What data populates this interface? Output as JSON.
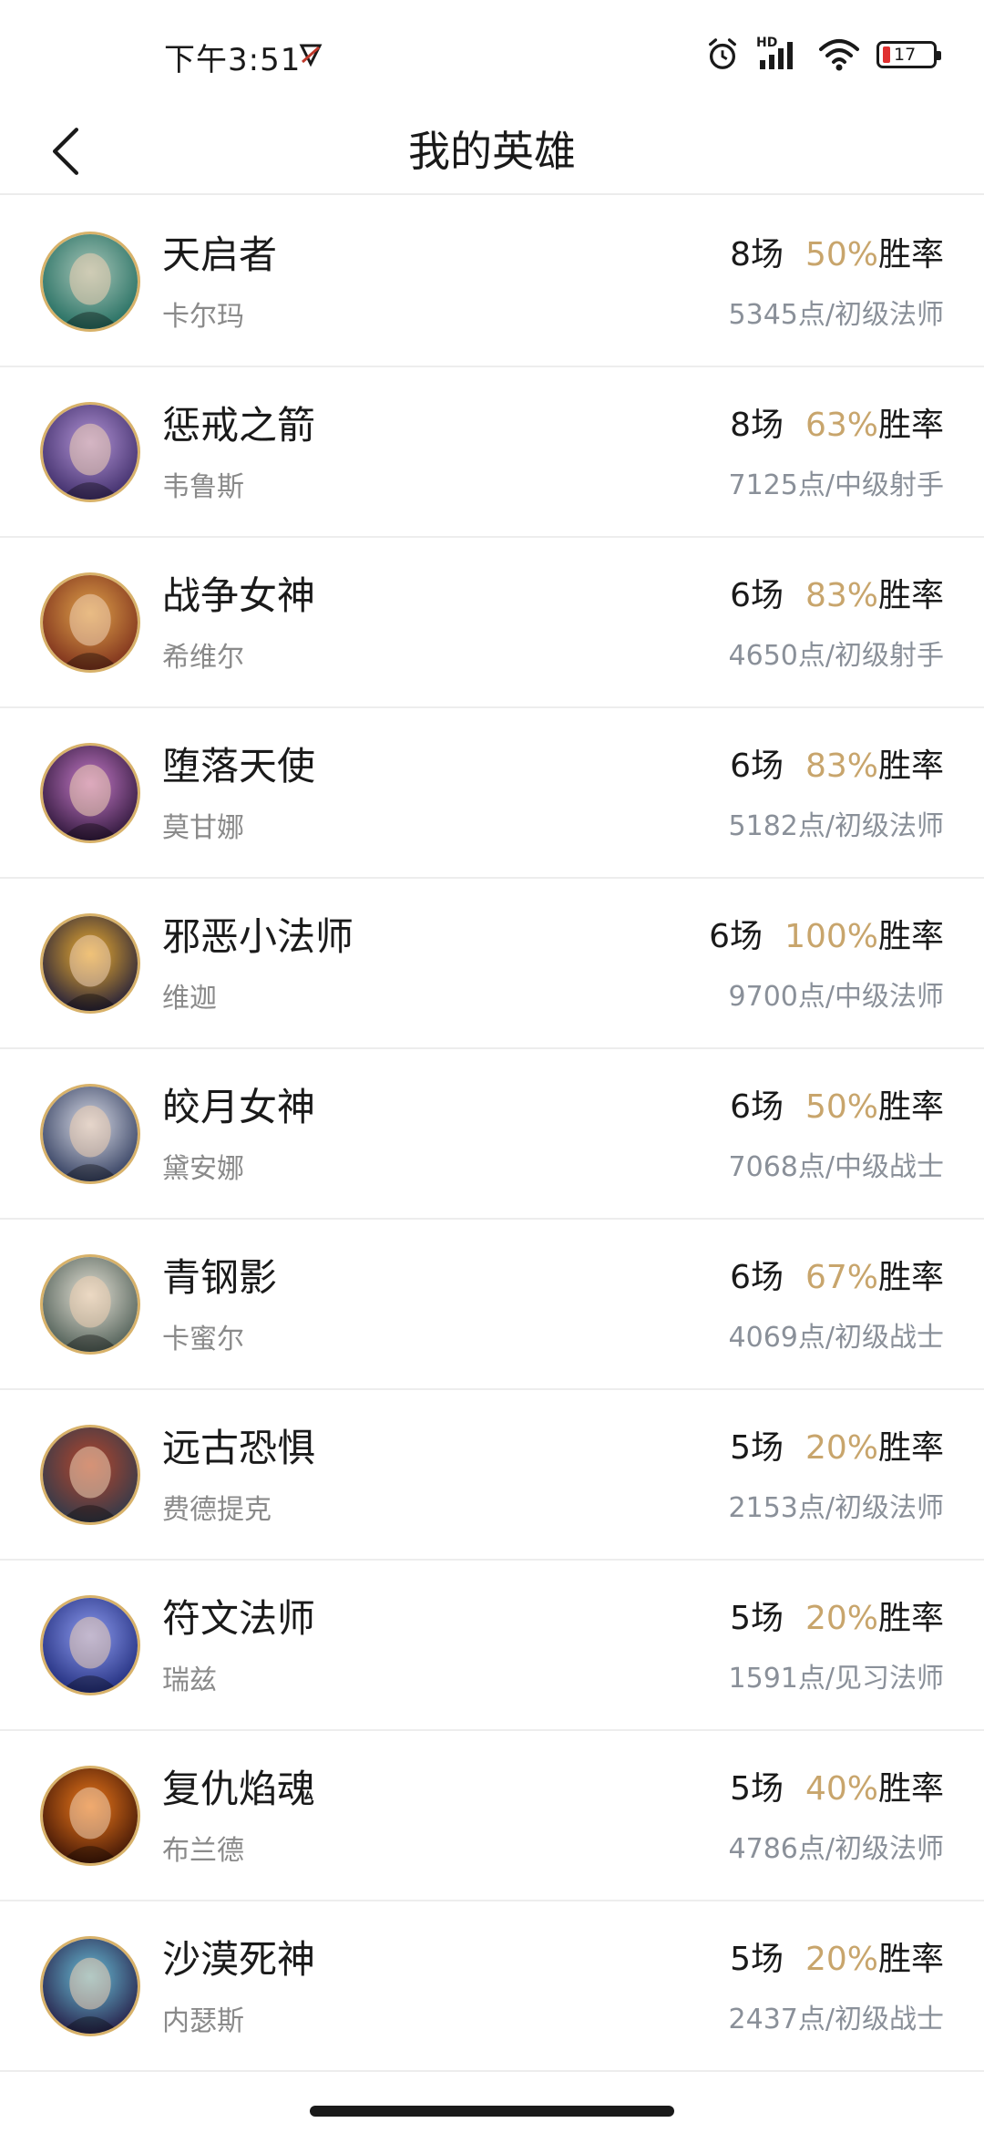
{
  "status_bar": {
    "time": "下午3:51",
    "network_label": "HD",
    "battery_level": "17",
    "icons": [
      "app-notification-icon",
      "alarm-icon",
      "signal-icon",
      "wifi-icon",
      "battery-icon"
    ]
  },
  "nav": {
    "title": "我的英雄",
    "back_icon": "chevron-left-icon"
  },
  "colors": {
    "winrate": "#c8a56c",
    "detail": "#8a9099",
    "name": "#8a8a8a",
    "avatar_ring": "#d8b26a",
    "battery_low": "#e03131"
  },
  "heroes": [
    {
      "title": "天启者",
      "name": "卡尔玛",
      "games": "8场",
      "winrate": "50%",
      "winrate_label": "胜率",
      "detail": "5345点/初级法师",
      "avatar_colors": [
        "#1f6b5e",
        "#a8c6b8"
      ]
    },
    {
      "title": "惩戒之箭",
      "name": "韦鲁斯",
      "games": "8场",
      "winrate": "63%",
      "winrate_label": "胜率",
      "detail": "7125点/中级射手",
      "avatar_colors": [
        "#3b2a66",
        "#b394d6"
      ]
    },
    {
      "title": "战争女神",
      "name": "希维尔",
      "games": "6场",
      "winrate": "83%",
      "winrate_label": "胜率",
      "detail": "4650点/初级射手",
      "avatar_colors": [
        "#7a2c1a",
        "#e0a24a"
      ]
    },
    {
      "title": "堕落天使",
      "name": "莫甘娜",
      "games": "6场",
      "winrate": "83%",
      "winrate_label": "胜率",
      "detail": "5182点/初级法师",
      "avatar_colors": [
        "#2a1436",
        "#c67ac8"
      ]
    },
    {
      "title": "邪恶小法师",
      "name": "维迦",
      "games": "6场",
      "winrate": "100%",
      "winrate_label": "胜率",
      "detail": "9700点/中级法师",
      "avatar_colors": [
        "#1c1a3a",
        "#f0b030"
      ]
    },
    {
      "title": "皎月女神",
      "name": "黛安娜",
      "games": "6场",
      "winrate": "50%",
      "winrate_label": "胜率",
      "detail": "7068点/中级战士",
      "avatar_colors": [
        "#2e3a5c",
        "#d9dbe6"
      ]
    },
    {
      "title": "青钢影",
      "name": "卡蜜尔",
      "games": "6场",
      "winrate": "67%",
      "winrate_label": "胜率",
      "detail": "4069点/初级战士",
      "avatar_colors": [
        "#4a5a52",
        "#e6e2d6"
      ]
    },
    {
      "title": "远古恐惧",
      "name": "费德提克",
      "games": "5场",
      "winrate": "20%",
      "winrate_label": "胜率",
      "detail": "2153点/初级法师",
      "avatar_colors": [
        "#2c3a4c",
        "#b6462c"
      ]
    },
    {
      "title": "符文法师",
      "name": "瑞兹",
      "games": "5场",
      "winrate": "20%",
      "winrate_label": "胜率",
      "detail": "1591点/见习法师",
      "avatar_colors": [
        "#1e2a7a",
        "#8e9cf0"
      ]
    },
    {
      "title": "复仇焰魂",
      "name": "布兰德",
      "games": "5场",
      "winrate": "40%",
      "winrate_label": "胜率",
      "detail": "4786点/初级法师",
      "avatar_colors": [
        "#3a1206",
        "#f07a1a"
      ]
    },
    {
      "title": "沙漠死神",
      "name": "内瑟斯",
      "games": "5场",
      "winrate": "20%",
      "winrate_label": "胜率",
      "detail": "2437点/初级战士",
      "avatar_colors": [
        "#241a44",
        "#6ac0d8"
      ]
    }
  ]
}
